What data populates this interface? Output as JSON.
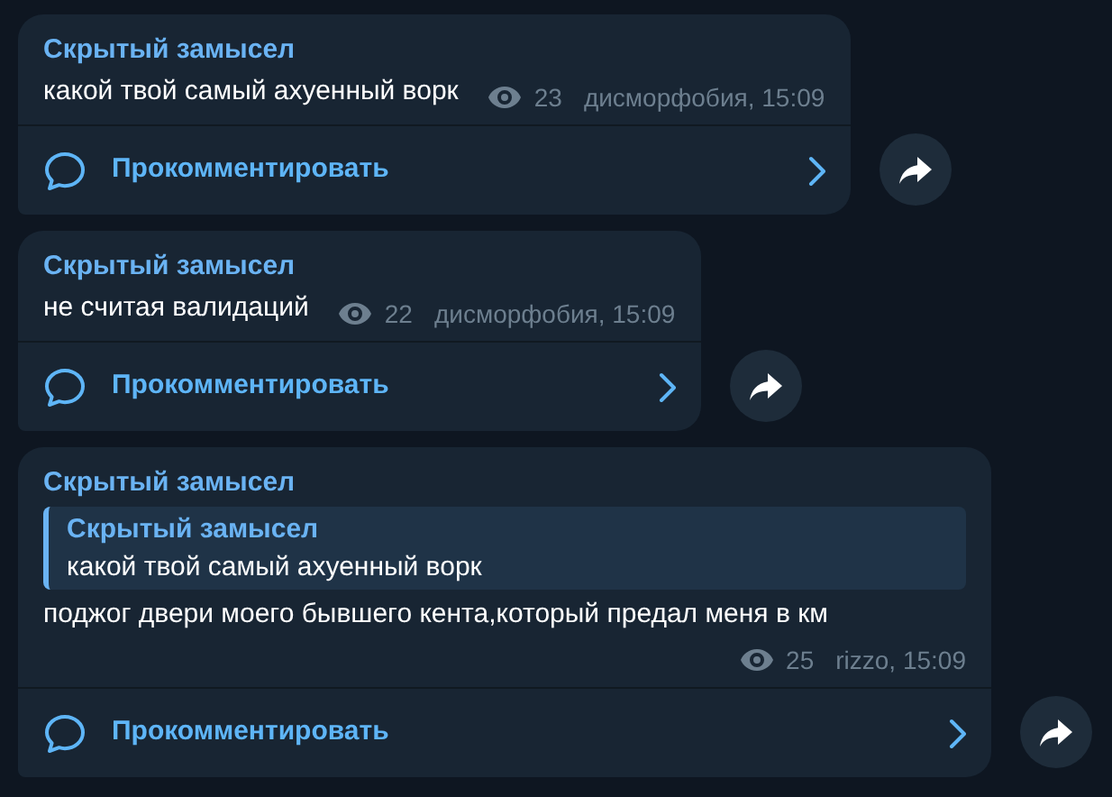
{
  "messages": [
    {
      "author": "Скрытый замысел",
      "text": "какой твой самый ахуенный ворк",
      "views": "23",
      "signature": "дисморфобия, 15:09",
      "comment_label": "Прокомментировать"
    },
    {
      "author": "Скрытый замысел",
      "text": "не считая валидаций",
      "views": "22",
      "signature": "дисморфобия, 15:09",
      "comment_label": "Прокомментировать"
    },
    {
      "author": "Скрытый замысел",
      "quote": {
        "author": "Скрытый замысел",
        "text": "какой твой самый ахуенный ворк"
      },
      "text": "поджог двери моего бывшего кента,который предал меня в км",
      "views": "25",
      "signature": "rizzo, 15:09",
      "comment_label": "Прокомментировать"
    }
  ]
}
